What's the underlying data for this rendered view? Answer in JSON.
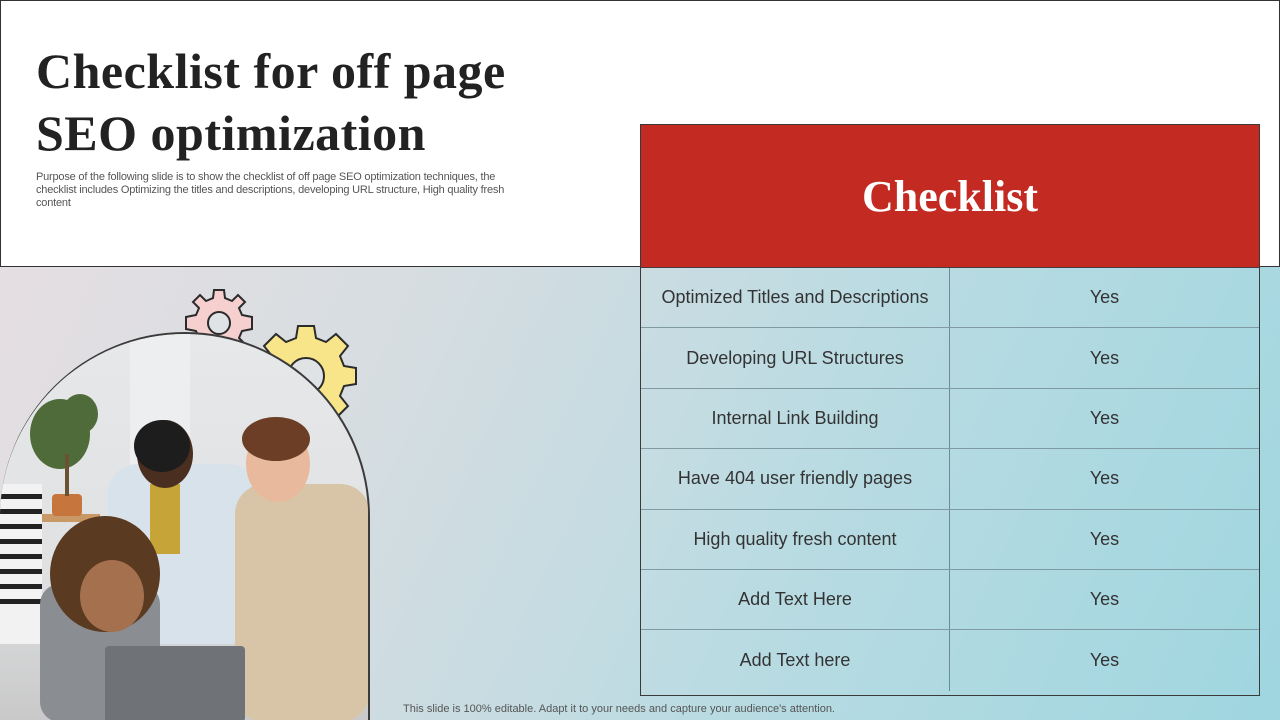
{
  "slide": {
    "title": "Checklist for off page SEO optimization",
    "subtitle": "Purpose of the following slide is to show the checklist of off page SEO optimization techniques, the checklist includes Optimizing the titles and descriptions, developing URL structure, High quality fresh content",
    "footer_note": "This slide is 100% editable. Adapt it to your needs and capture your audience's attention."
  },
  "checklist": {
    "header": "Checklist",
    "header_color": "#c22a22",
    "rows": [
      {
        "item": "Optimized Titles and Descriptions",
        "status": "Yes"
      },
      {
        "item": "Developing URL Structures",
        "status": "Yes"
      },
      {
        "item": "Internal Link Building",
        "status": "Yes"
      },
      {
        "item": "Have 404 user friendly pages",
        "status": "Yes"
      },
      {
        "item": "High quality  fresh content",
        "status": "Yes"
      },
      {
        "item": "Add Text Here",
        "status": "Yes"
      },
      {
        "item": "Add Text here",
        "status": "Yes"
      }
    ]
  },
  "illustration": {
    "photo": "team-working-at-laptop-photo",
    "icons": [
      "gear-icon-pink",
      "gear-icon-yellow"
    ]
  }
}
